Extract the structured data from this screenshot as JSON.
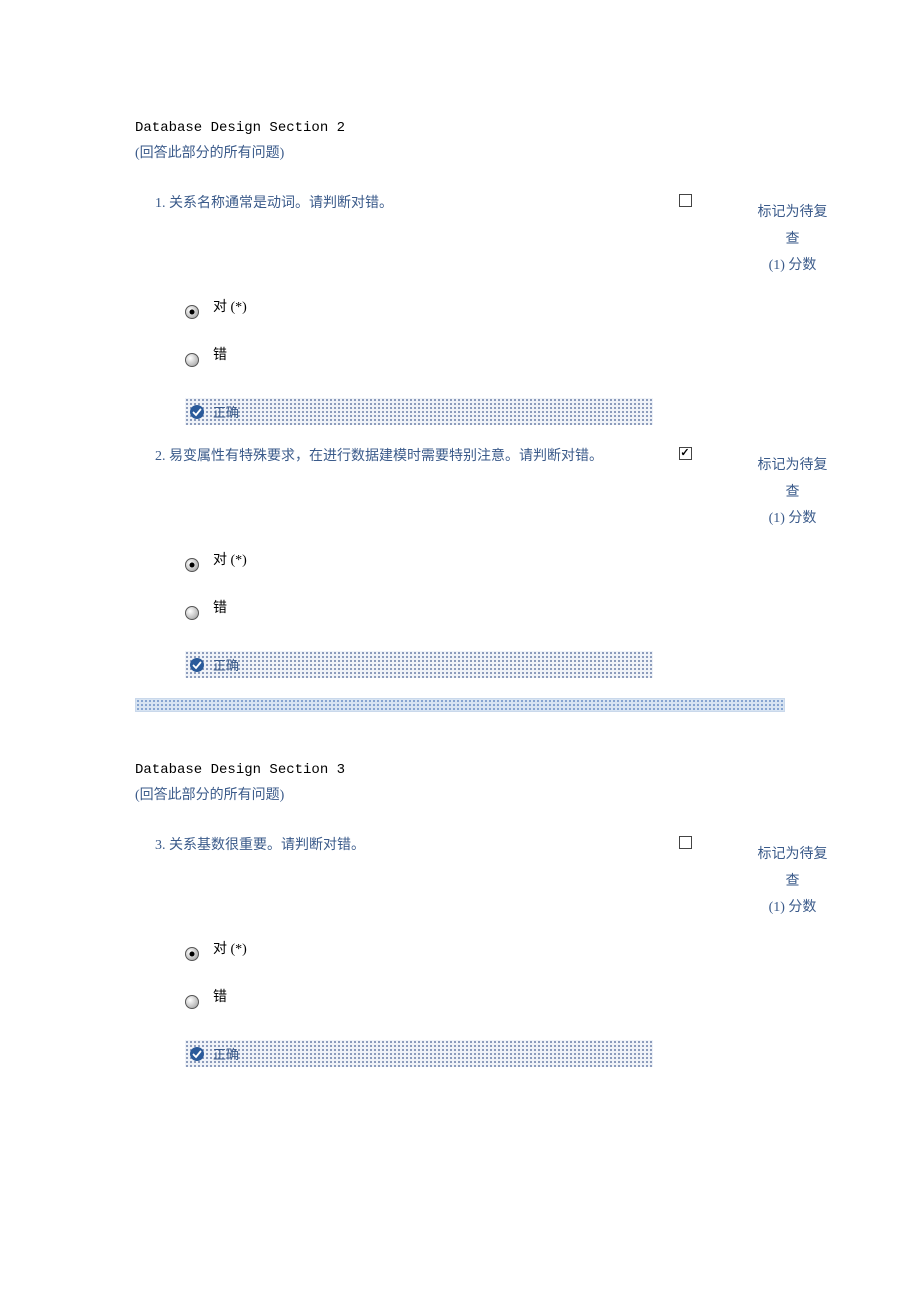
{
  "sections": [
    {
      "title": "Database Design Section 2",
      "subtitle": "(回答此部分的所有问题)",
      "questions": [
        {
          "number": "1.",
          "text": "关系名称通常是动词。请判断对错。",
          "review_checked": false,
          "review_label_l1": "标记为待复",
          "review_label_l2": "查",
          "points": "(1) 分数",
          "options": [
            {
              "label": "对 (*)",
              "selected": true
            },
            {
              "label": "错",
              "selected": false
            }
          ],
          "result": "正确"
        },
        {
          "number": "2.",
          "text": "易变属性有特殊要求，在进行数据建模时需要特别注意。请判断对错。",
          "review_checked": true,
          "review_label_l1": "标记为待复",
          "review_label_l2": "查",
          "points": "(1) 分数",
          "options": [
            {
              "label": "对 (*)",
              "selected": true
            },
            {
              "label": "错",
              "selected": false
            }
          ],
          "result": "正确"
        }
      ]
    },
    {
      "title": "Database Design Section 3",
      "subtitle": "(回答此部分的所有问题)",
      "questions": [
        {
          "number": "3.",
          "text": "关系基数很重要。请判断对错。",
          "review_checked": false,
          "review_label_l1": "标记为待复",
          "review_label_l2": "查",
          "points": "(1) 分数",
          "options": [
            {
              "label": "对 (*)",
              "selected": true
            },
            {
              "label": "错",
              "selected": false
            }
          ],
          "result": "正确"
        }
      ]
    }
  ]
}
